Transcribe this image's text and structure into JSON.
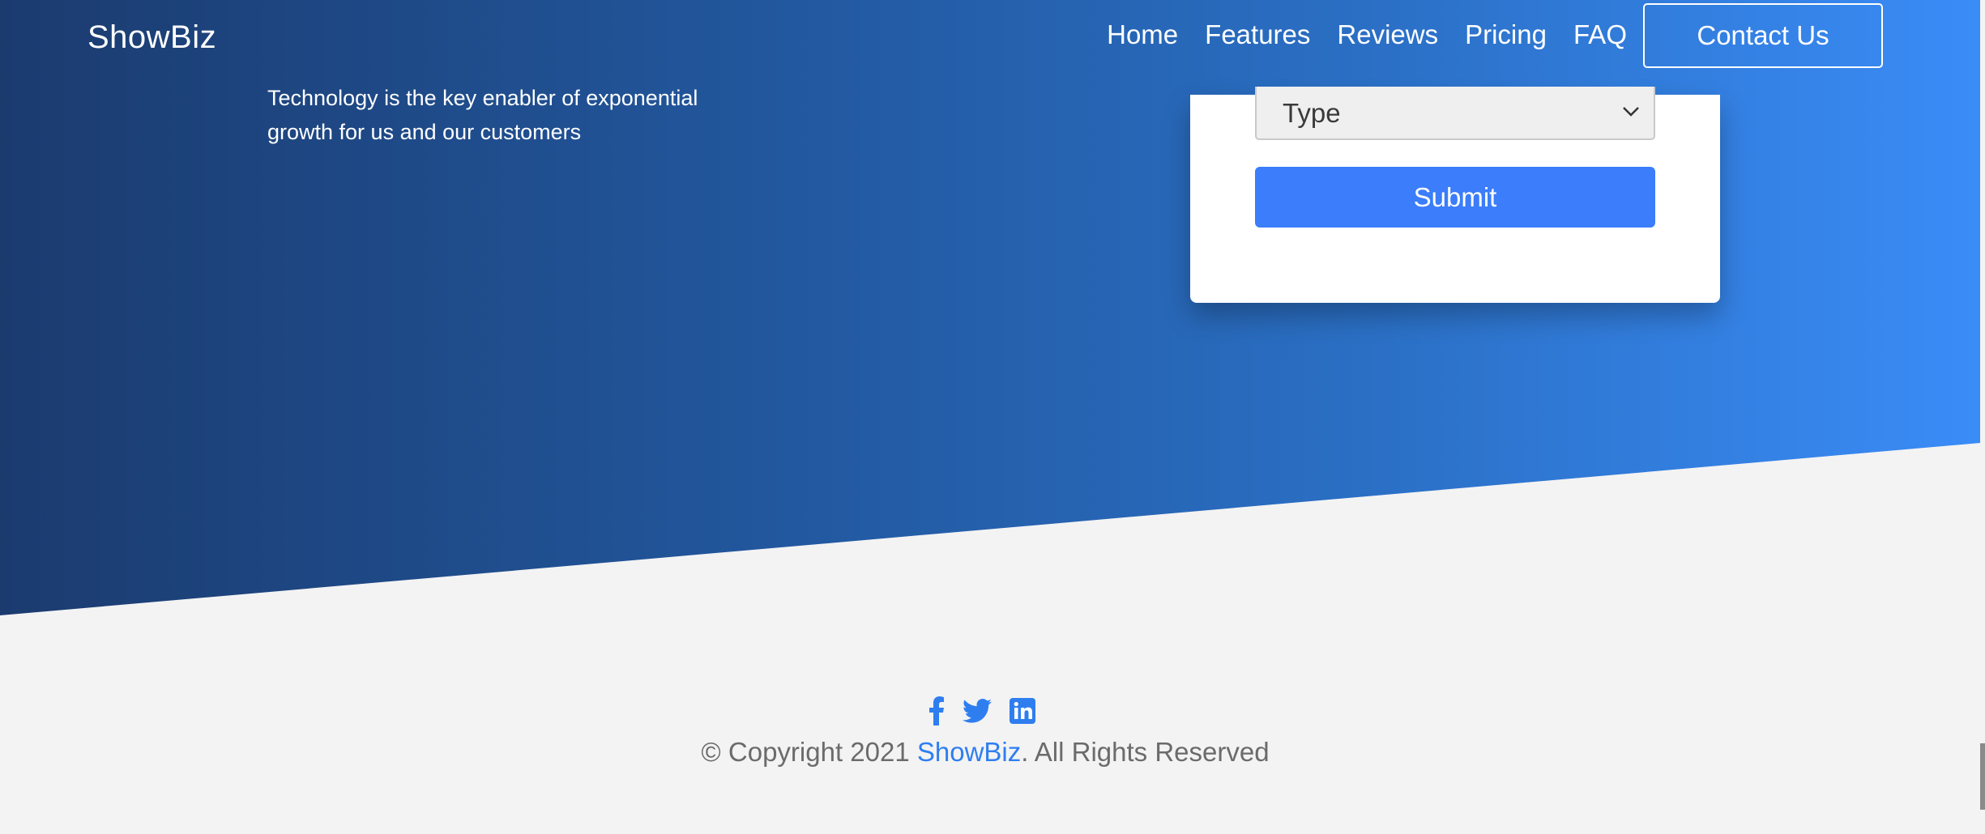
{
  "header": {
    "brand": "ShowBiz",
    "nav": [
      "Home",
      "Features",
      "Reviews",
      "Pricing",
      "FAQ"
    ],
    "cta": "Contact Us"
  },
  "hero": {
    "text": "Technology is the key enabler of exponential growth for us and our customers"
  },
  "form": {
    "type_selected": "Type",
    "submit": "Submit"
  },
  "footer": {
    "social": [
      "facebook-icon",
      "twitter-icon",
      "linkedin-icon"
    ],
    "copyright_prefix": "© Copyright 2021 ",
    "copyright_brand": "ShowBiz",
    "copyright_suffix": ". All Rights Reserved"
  },
  "colors": {
    "gradient_start": "#1b3b6f",
    "gradient_end": "#3a8cf7",
    "accent": "#3b7dfa",
    "footer_bg": "#f3f3f3"
  }
}
